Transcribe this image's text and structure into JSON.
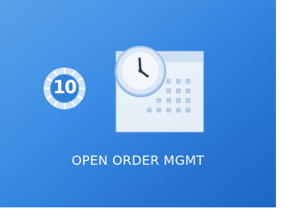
{
  "tile": {
    "label": "OPEN ORDER MGMT",
    "badge_count": "10",
    "icon": "calendar-clock-icon",
    "accent_color": "#3d8ee6"
  }
}
